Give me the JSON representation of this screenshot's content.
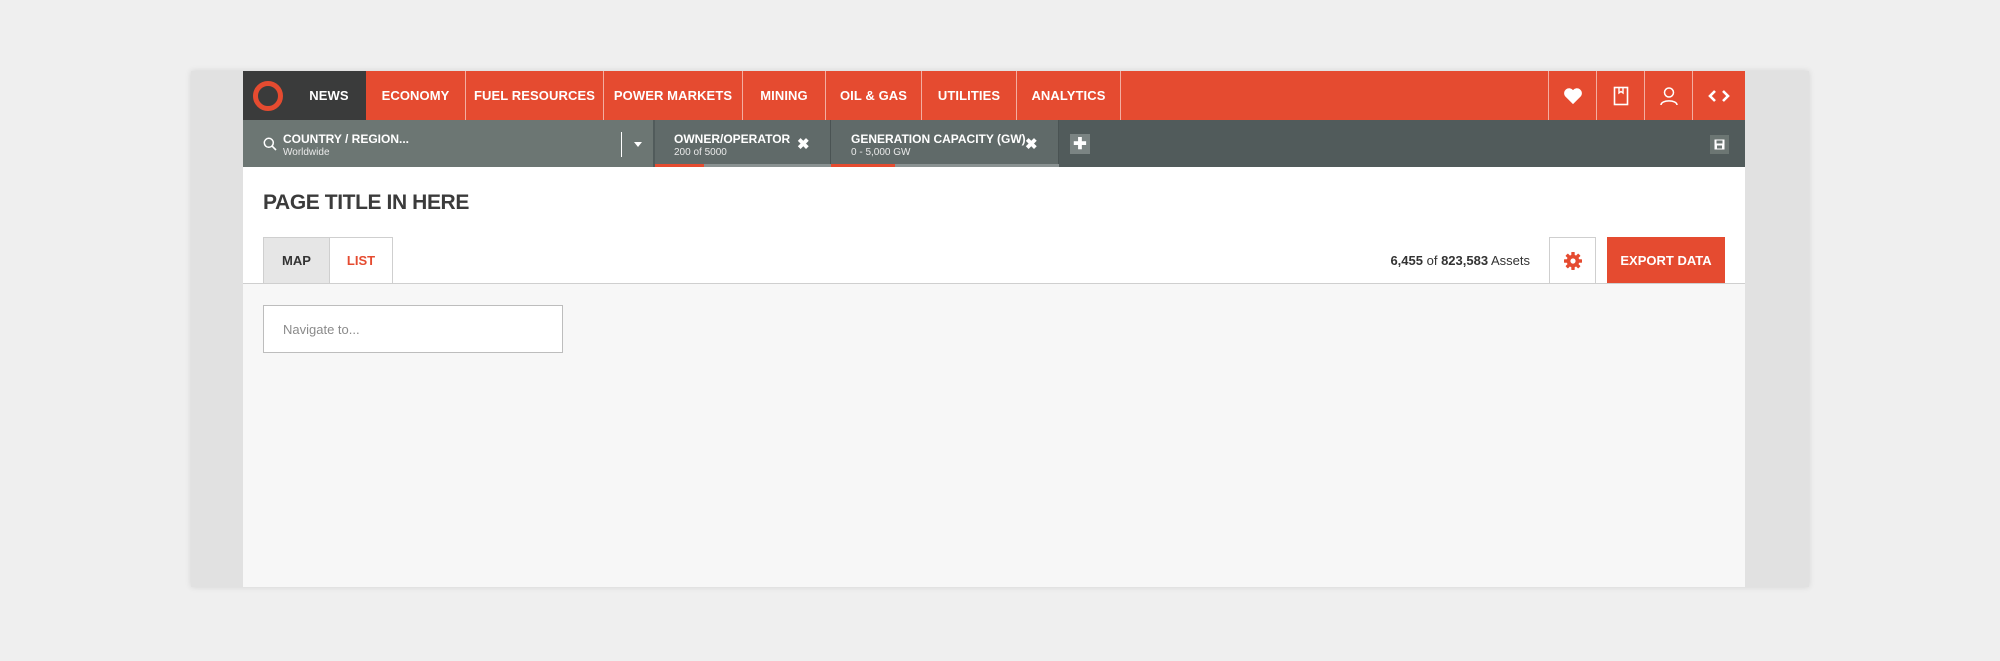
{
  "nav": {
    "items": [
      {
        "label": "News",
        "active": true
      },
      {
        "label": "Economy"
      },
      {
        "label": "Fuel Resources"
      },
      {
        "label": "Power Markets"
      },
      {
        "label": "Mining"
      },
      {
        "label": "Oil & Gas"
      },
      {
        "label": "Utilities"
      },
      {
        "label": "Analytics"
      }
    ],
    "right_icons": [
      "heart-icon",
      "bookmark-icon",
      "user-icon",
      "code-icon"
    ]
  },
  "filters": {
    "country": {
      "title": "Country / Region...",
      "value": "Worldwide"
    },
    "chips": [
      {
        "title": "Owner/Operator",
        "value": "200 of 5000",
        "fill_fraction": 0.28
      },
      {
        "title": "Generation Capacity (GW)",
        "value": "0 - 5,000 GW",
        "fill_fraction": 0.28
      }
    ]
  },
  "page": {
    "title": "Page title in here",
    "tabs": [
      {
        "label": "Map",
        "active": true
      },
      {
        "label": "List"
      }
    ],
    "assets": {
      "shown": "6,455",
      "of": "of",
      "total": "823,583",
      "unit": "Assets"
    },
    "export_label": "Export Data",
    "navigate_placeholder": "Navigate to..."
  },
  "colors": {
    "accent": "#e54b30",
    "dark": "#3a3b3b",
    "filterbar": "#515b5b"
  }
}
